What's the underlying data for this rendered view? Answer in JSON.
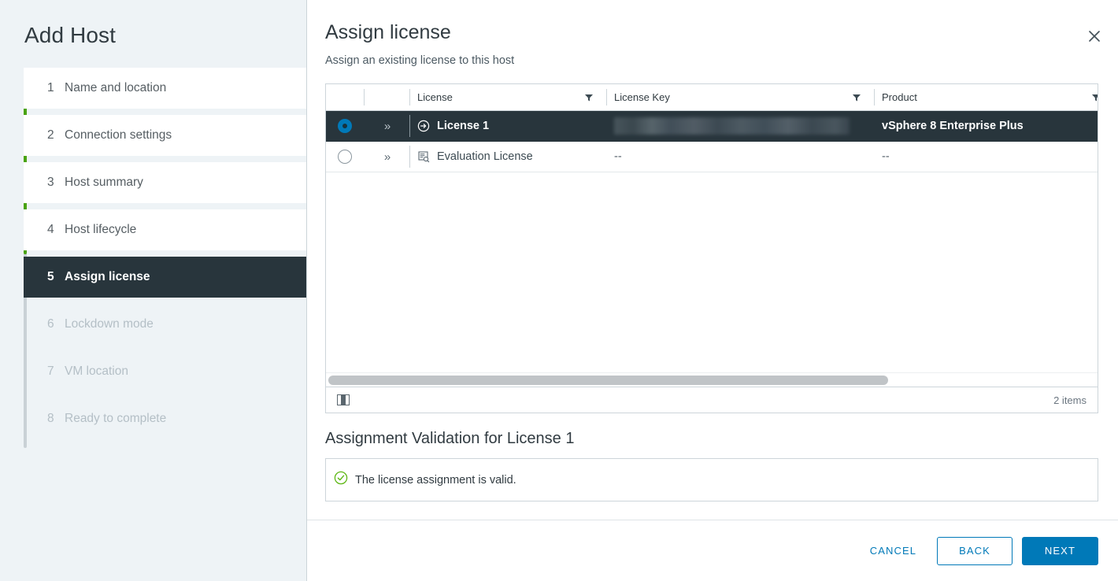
{
  "wizard": {
    "title": "Add Host",
    "steps": [
      {
        "num": "1",
        "label": "Name and location",
        "state": "done"
      },
      {
        "num": "2",
        "label": "Connection settings",
        "state": "done"
      },
      {
        "num": "3",
        "label": "Host summary",
        "state": "done"
      },
      {
        "num": "4",
        "label": "Host lifecycle",
        "state": "done"
      },
      {
        "num": "5",
        "label": "Assign license",
        "state": "active"
      },
      {
        "num": "6",
        "label": "Lockdown mode",
        "state": "future"
      },
      {
        "num": "7",
        "label": "VM location",
        "state": "future"
      },
      {
        "num": "8",
        "label": "Ready to complete",
        "state": "future"
      }
    ]
  },
  "page": {
    "title": "Assign license",
    "subtitle": "Assign an existing license to this host",
    "close_icon": "close-icon"
  },
  "grid": {
    "columns": [
      {
        "key": "select",
        "label": "",
        "filter": false
      },
      {
        "key": "expand",
        "label": "",
        "filter": false
      },
      {
        "key": "license",
        "label": "License",
        "filter": true
      },
      {
        "key": "key",
        "label": "License Key",
        "filter": true
      },
      {
        "key": "product",
        "label": "Product",
        "filter": true
      }
    ],
    "rows": [
      {
        "selected": true,
        "expand_icon": "chevron-double-right-icon",
        "license_icon": "license-arrow-icon",
        "license": "License 1",
        "license_key": "",
        "license_key_redacted": true,
        "product": "vSphere 8 Enterprise Plus"
      },
      {
        "selected": false,
        "expand_icon": "chevron-double-right-icon",
        "license_icon": "evaluation-license-icon",
        "license": "Evaluation License",
        "license_key": "--",
        "license_key_redacted": false,
        "product": "--"
      }
    ],
    "footer": {
      "column_picker_icon": "column-picker-icon",
      "items_count": "2 items"
    }
  },
  "validation": {
    "title": "Assignment Validation for License 1",
    "status_icon": "check-circle-icon",
    "message": "The license assignment is valid."
  },
  "footer_buttons": {
    "cancel": "CANCEL",
    "back": "BACK",
    "next": "NEXT"
  },
  "colors": {
    "accent": "#0079b8",
    "selected_row": "#28353c",
    "progress_green": "#4aa312",
    "success_green": "#5eb715",
    "sidebar_bg": "#eef3f6"
  }
}
